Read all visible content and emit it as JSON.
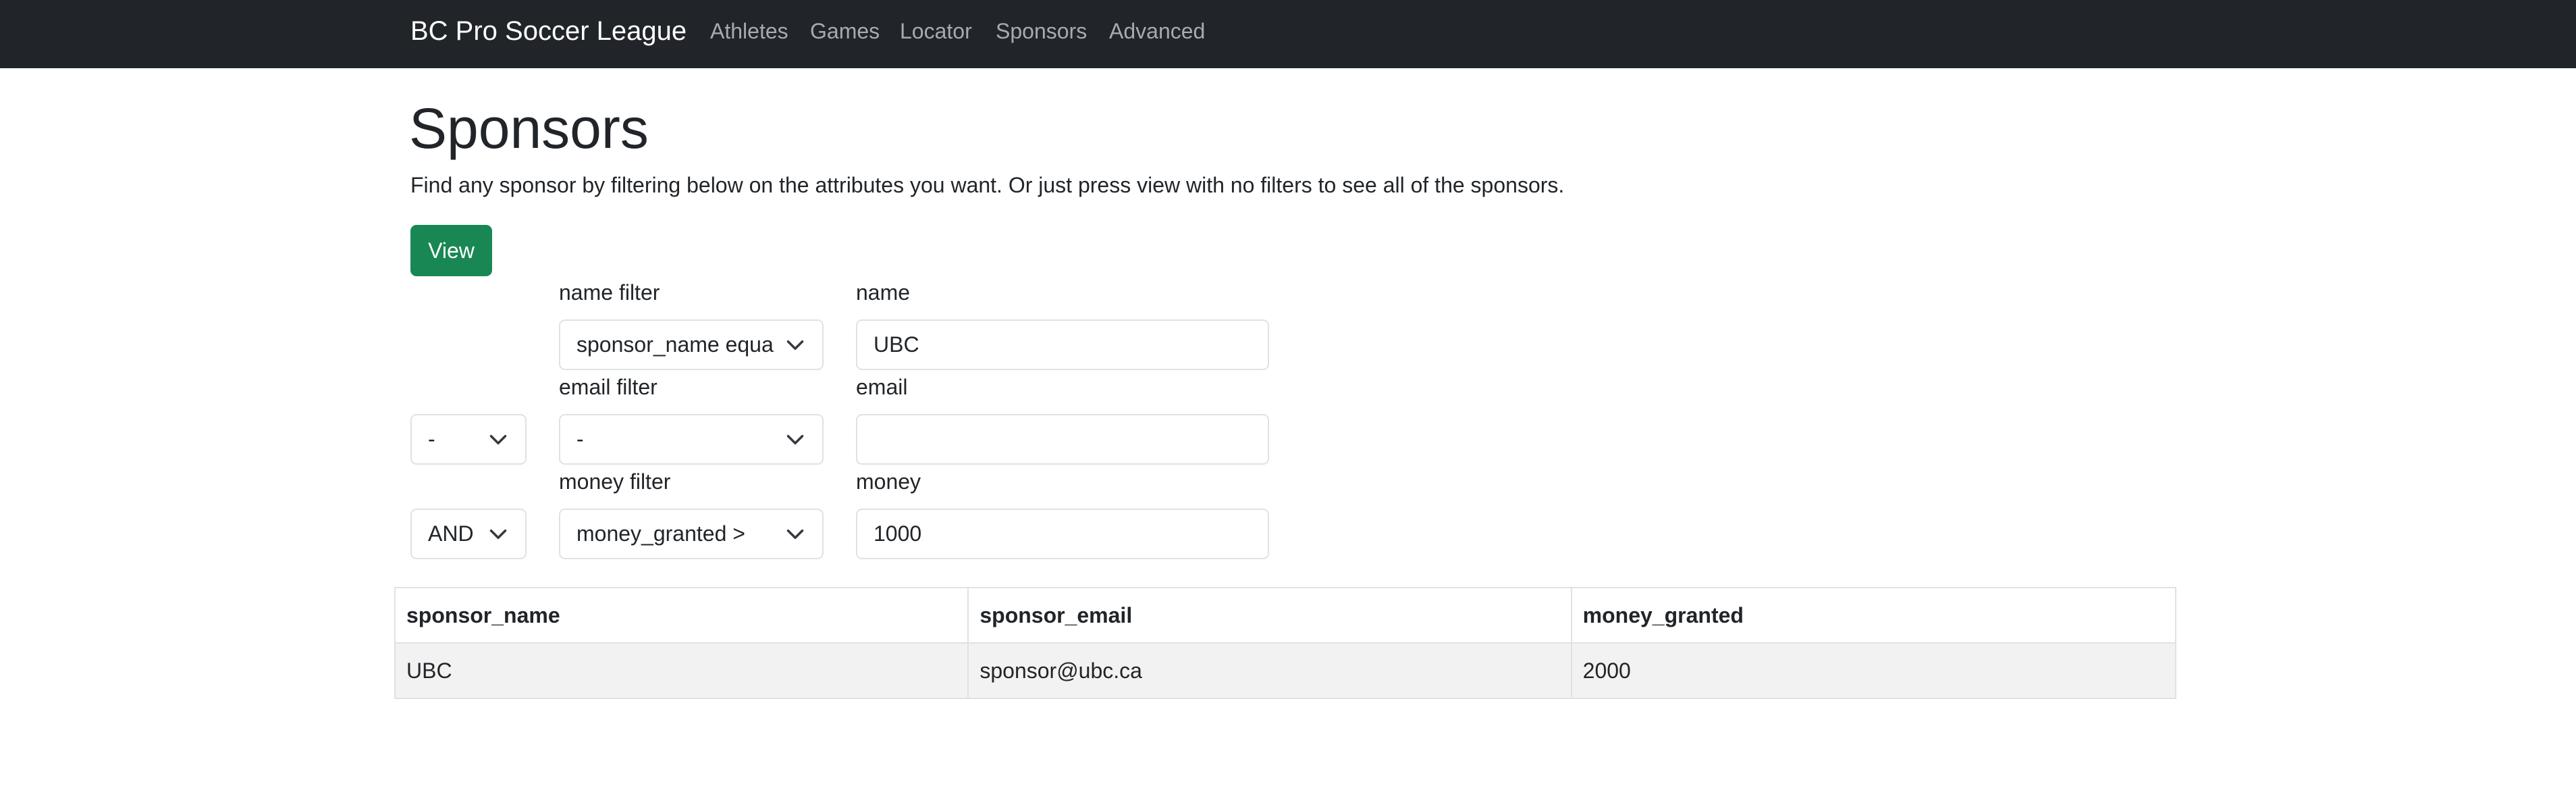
{
  "navbar": {
    "brand": "BC Pro Soccer League",
    "links": [
      "Athletes",
      "Games",
      "Locator",
      "Sponsors",
      "Advanced"
    ]
  },
  "page": {
    "title": "Sponsors",
    "description": "Find any sponsor by filtering below on the attributes you want. Or just press view with no filters to see all of the sponsors.",
    "view_button": "View"
  },
  "filters": {
    "name": {
      "filter_label": "name filter",
      "filter_value": "sponsor_name equa",
      "value_label": "name",
      "value": "UBC"
    },
    "email": {
      "connector": "-",
      "filter_label": "email filter",
      "filter_value": "-",
      "value_label": "email",
      "value": ""
    },
    "money": {
      "connector": "AND",
      "filter_label": "money filter",
      "filter_value": "money_granted >",
      "value_label": "money",
      "value": "1000"
    }
  },
  "results": {
    "columns": [
      "sponsor_name",
      "sponsor_email",
      "money_granted"
    ],
    "rows": [
      [
        "UBC",
        "sponsor@ubc.ca",
        "2000"
      ]
    ]
  },
  "icons": {
    "select_arrow": "chevron-down-icon"
  }
}
